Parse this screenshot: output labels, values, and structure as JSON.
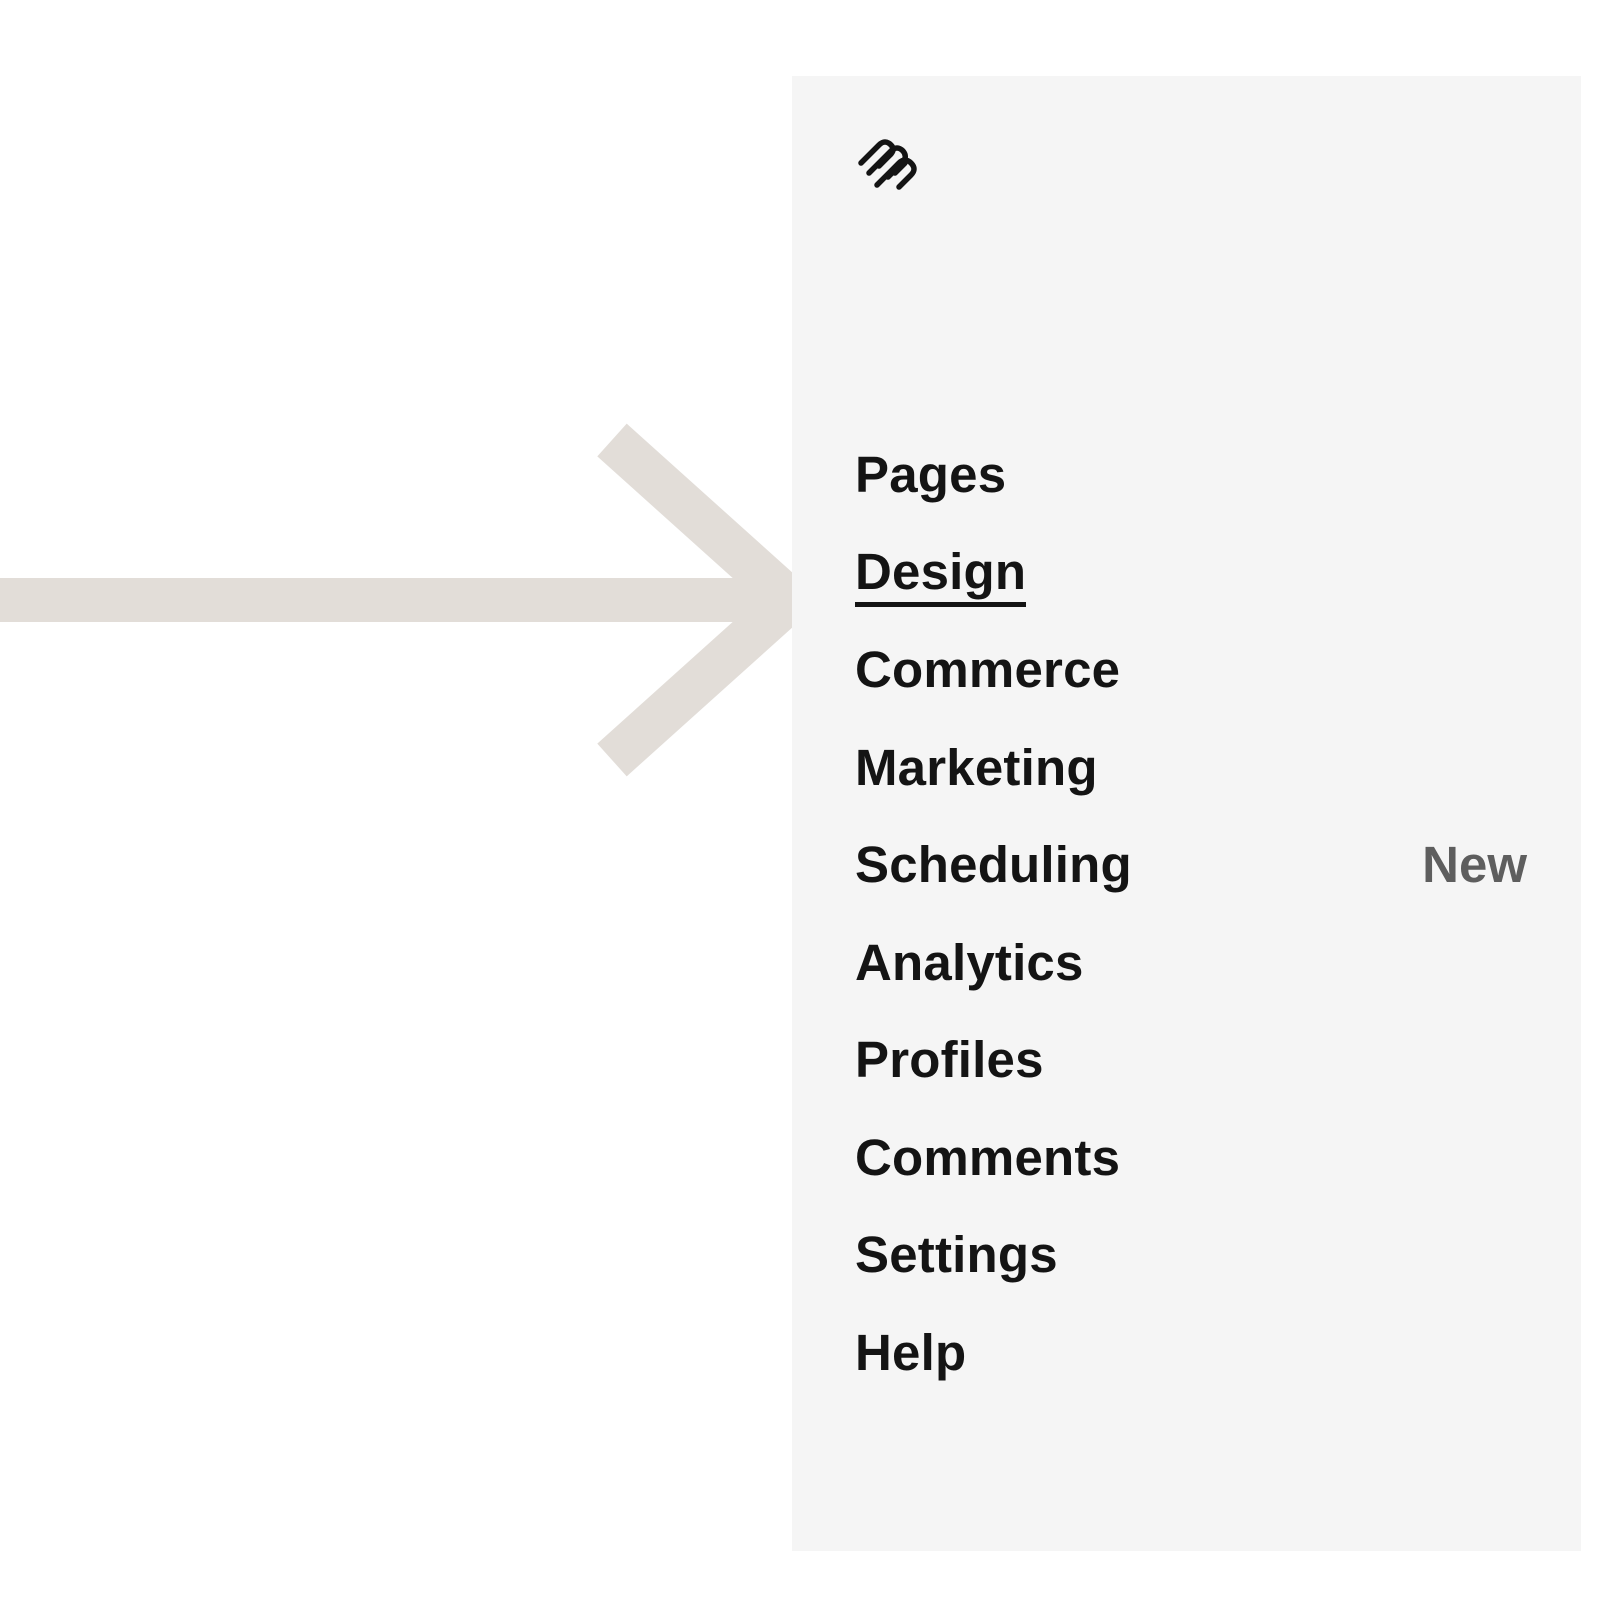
{
  "logo": {
    "icon": "squarespace-logo-icon"
  },
  "nav": {
    "items": [
      {
        "label": "Pages",
        "active": false,
        "badge": ""
      },
      {
        "label": "Design",
        "active": true,
        "badge": ""
      },
      {
        "label": "Commerce",
        "active": false,
        "badge": ""
      },
      {
        "label": "Marketing",
        "active": false,
        "badge": ""
      },
      {
        "label": "Scheduling",
        "active": false,
        "badge": "New"
      },
      {
        "label": "Analytics",
        "active": false,
        "badge": ""
      },
      {
        "label": "Profiles",
        "active": false,
        "badge": ""
      },
      {
        "label": "Comments",
        "active": false,
        "badge": ""
      },
      {
        "label": "Settings",
        "active": false,
        "badge": ""
      },
      {
        "label": "Help",
        "active": false,
        "badge": ""
      }
    ]
  },
  "colors": {
    "panel_background": "#f5f5f5",
    "arrow": "#e2ddd8",
    "text": "#141414",
    "badge_text": "#5e5e5e"
  }
}
